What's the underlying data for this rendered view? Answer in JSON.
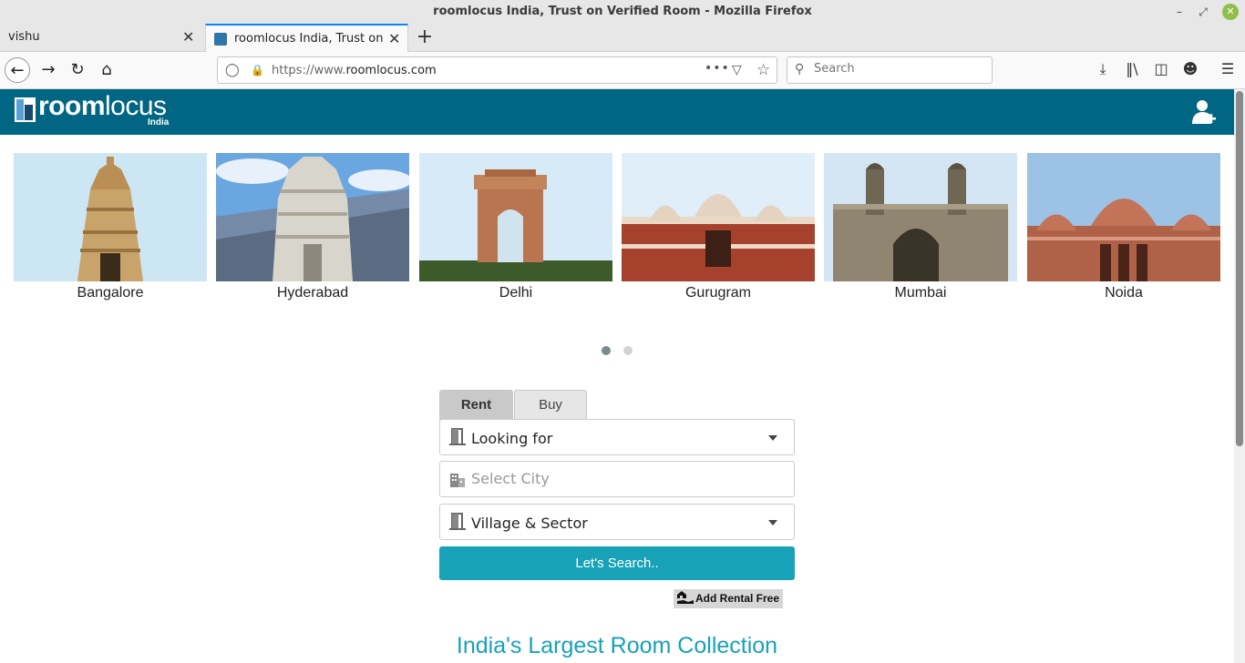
{
  "window": {
    "title": "roomlocus India, Trust on Verified Room - Mozilla Firefox"
  },
  "tabs": [
    {
      "label": "vishu",
      "active": false
    },
    {
      "label": "roomlocus India, Trust on V",
      "active": true
    }
  ],
  "toolbar": {
    "url_prefix": "https://www.",
    "url_domain": "roomlocus.com",
    "search_placeholder": "Search"
  },
  "site": {
    "logo_text_bold": "room",
    "logo_text_light": "locus",
    "logo_sub": "India",
    "header_color": "#006684",
    "accent_color": "#17a2b8"
  },
  "cities": [
    {
      "name": "Bangalore"
    },
    {
      "name": "Hyderabad"
    },
    {
      "name": "Delhi"
    },
    {
      "name": "Gurugram"
    },
    {
      "name": "Mumbai"
    },
    {
      "name": "Noida"
    }
  ],
  "carousel": {
    "pages": 2,
    "active_page": 1
  },
  "search_form": {
    "tabs": [
      "Rent",
      "Buy"
    ],
    "active_tab": "Rent",
    "looking_for": "Looking for",
    "city_placeholder": "Select City",
    "village_sector": "Village & Sector",
    "search_button": "Let's Search..",
    "add_rental": "Add Rental Free"
  },
  "tagline": "India's Largest Room Collection"
}
